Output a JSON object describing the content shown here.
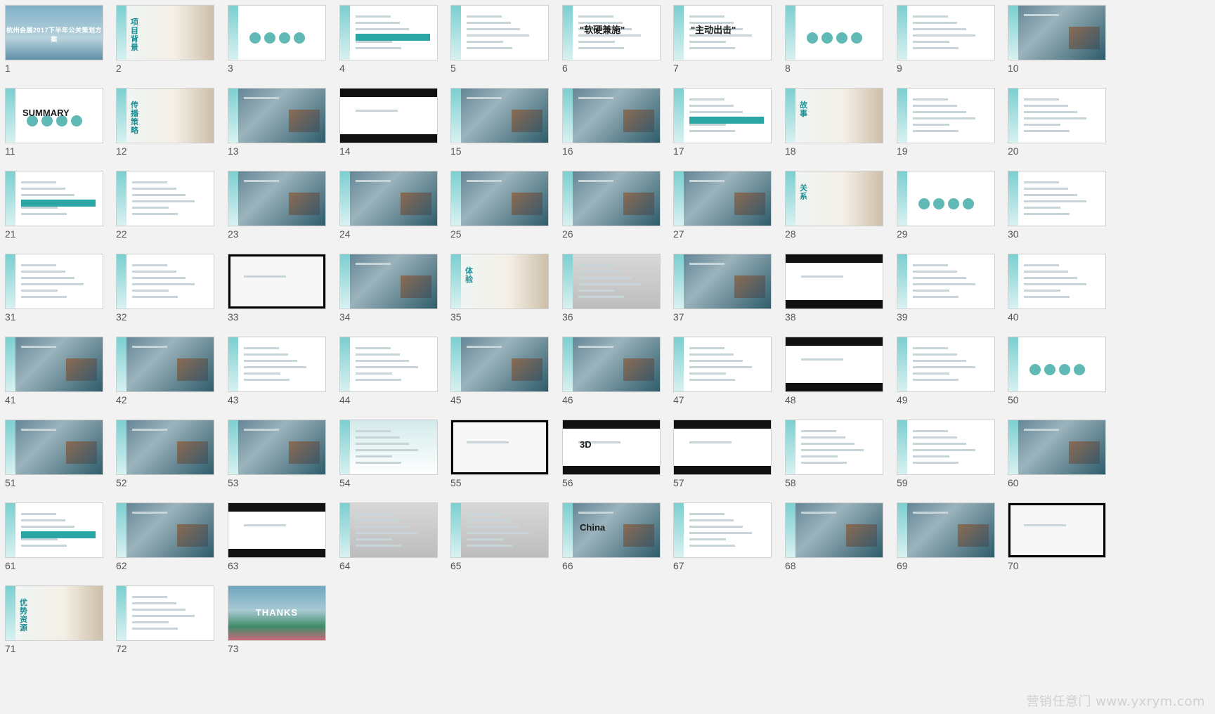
{
  "slides": [
    {
      "number": "1",
      "style": "cover",
      "text": "杭州会展2017下半年公关策划方案"
    },
    {
      "number": "2",
      "style": "title",
      "text": "项目背景"
    },
    {
      "number": "3",
      "style": "dots"
    },
    {
      "number": "4",
      "style": "table"
    },
    {
      "number": "5",
      "style": "text"
    },
    {
      "number": "6",
      "style": "text",
      "text": "\"软硬兼施\""
    },
    {
      "number": "7",
      "style": "text",
      "text": "\"主动出击\""
    },
    {
      "number": "8",
      "style": "dots"
    },
    {
      "number": "9",
      "style": "text"
    },
    {
      "number": "10",
      "style": "photo"
    },
    {
      "number": "11",
      "style": "dots",
      "text": "SUMMARY"
    },
    {
      "number": "12",
      "style": "title",
      "text": "传播策略"
    },
    {
      "number": "13",
      "style": "photo"
    },
    {
      "number": "14",
      "style": "dark"
    },
    {
      "number": "15",
      "style": "photo"
    },
    {
      "number": "16",
      "style": "photo"
    },
    {
      "number": "17",
      "style": "table"
    },
    {
      "number": "18",
      "style": "title",
      "text": "故事"
    },
    {
      "number": "19",
      "style": "text"
    },
    {
      "number": "20",
      "style": "text"
    },
    {
      "number": "21",
      "style": "table"
    },
    {
      "number": "22",
      "style": "text"
    },
    {
      "number": "23",
      "style": "photo"
    },
    {
      "number": "24",
      "style": "photo"
    },
    {
      "number": "25",
      "style": "photo"
    },
    {
      "number": "26",
      "style": "photo"
    },
    {
      "number": "27",
      "style": "photo"
    },
    {
      "number": "28",
      "style": "title",
      "text": "关系"
    },
    {
      "number": "29",
      "style": "dots"
    },
    {
      "number": "30",
      "style": "text"
    },
    {
      "number": "31",
      "style": "text"
    },
    {
      "number": "32",
      "style": "text"
    },
    {
      "number": "33",
      "style": "blackframe"
    },
    {
      "number": "34",
      "style": "photo"
    },
    {
      "number": "35",
      "style": "title",
      "text": "体验"
    },
    {
      "number": "36",
      "style": "gray"
    },
    {
      "number": "37",
      "style": "photo"
    },
    {
      "number": "38",
      "style": "dark"
    },
    {
      "number": "39",
      "style": "text"
    },
    {
      "number": "40",
      "style": "text"
    },
    {
      "number": "41",
      "style": "photo"
    },
    {
      "number": "42",
      "style": "photo"
    },
    {
      "number": "43",
      "style": "text"
    },
    {
      "number": "44",
      "style": "text"
    },
    {
      "number": "45",
      "style": "photo"
    },
    {
      "number": "46",
      "style": "photo"
    },
    {
      "number": "47",
      "style": "text"
    },
    {
      "number": "48",
      "style": "dark"
    },
    {
      "number": "49",
      "style": "text"
    },
    {
      "number": "50",
      "style": "dots"
    },
    {
      "number": "51",
      "style": "photo"
    },
    {
      "number": "52",
      "style": "photo"
    },
    {
      "number": "53",
      "style": "photo"
    },
    {
      "number": "54",
      "style": "teal"
    },
    {
      "number": "55",
      "style": "blackframe"
    },
    {
      "number": "56",
      "style": "dark",
      "text": "3D"
    },
    {
      "number": "57",
      "style": "dark"
    },
    {
      "number": "58",
      "style": "text"
    },
    {
      "number": "59",
      "style": "text"
    },
    {
      "number": "60",
      "style": "photo"
    },
    {
      "number": "61",
      "style": "table"
    },
    {
      "number": "62",
      "style": "photo"
    },
    {
      "number": "63",
      "style": "dark"
    },
    {
      "number": "64",
      "style": "gray"
    },
    {
      "number": "65",
      "style": "gray"
    },
    {
      "number": "66",
      "style": "photo",
      "text": "China"
    },
    {
      "number": "67",
      "style": "text"
    },
    {
      "number": "68",
      "style": "photo"
    },
    {
      "number": "69",
      "style": "photo"
    },
    {
      "number": "70",
      "style": "blackframe"
    },
    {
      "number": "71",
      "style": "title",
      "text": "优势资源"
    },
    {
      "number": "72",
      "style": "text"
    },
    {
      "number": "73",
      "style": "thanks",
      "text": "THANKS"
    }
  ],
  "watermark": "营销任意门 www.yxrym.com",
  "colors": {
    "accent": "#2aa7a5",
    "background": "#f2f2f2",
    "number_text": "#555555"
  }
}
